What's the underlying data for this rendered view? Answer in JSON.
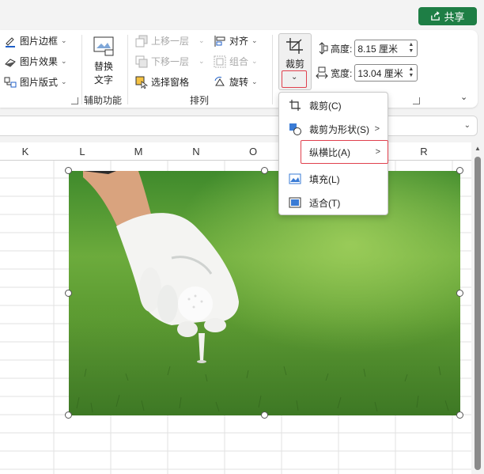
{
  "share": {
    "label": "共享"
  },
  "ribbon": {
    "picture_border": "图片边框",
    "picture_effects": "图片效果",
    "picture_layout": "图片版式",
    "alt_text": {
      "line1": "替换",
      "line2": "文字"
    },
    "accessibility_group": "辅助功能",
    "bring_forward": "上移一层",
    "send_backward": "下移一层",
    "selection_pane": "选择窗格",
    "align": "对齐",
    "group": "组合",
    "rotate": "旋转",
    "arrange_group": "排列",
    "crop": "裁剪",
    "height_label": "高度:",
    "height_value": "8.15 厘米",
    "width_label": "宽度:",
    "width_value": "13.04 厘米"
  },
  "columns": [
    "K",
    "L",
    "M",
    "N",
    "O",
    "R"
  ],
  "crop_menu": {
    "items": [
      {
        "label": "裁剪(C)",
        "icon": "crop-icon",
        "has_submenu": false
      },
      {
        "label": "裁剪为形状(S)",
        "icon": "shape-icon",
        "has_submenu": true
      },
      {
        "label": "纵横比(A)",
        "icon": "",
        "has_submenu": true,
        "highlighted": true
      },
      {
        "label": "填充(L)",
        "icon": "fill-icon",
        "has_submenu": false
      },
      {
        "label": "适合(T)",
        "icon": "fit-icon",
        "has_submenu": false
      }
    ]
  },
  "colors": {
    "share_green": "#1e7e45",
    "highlight_red": "#e0404d"
  },
  "picture": {
    "subject": "golf-glove-hand-placing-ball-on-tee"
  }
}
